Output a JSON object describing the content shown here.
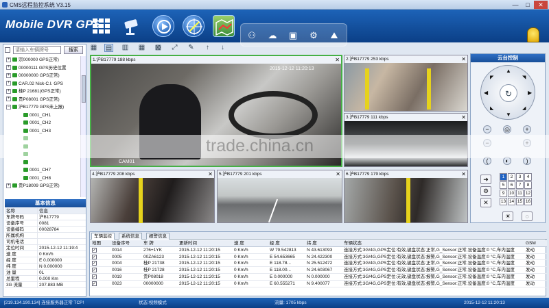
{
  "window": {
    "title": "CMS远程监控系统 V3.15",
    "min": "—",
    "max": "□",
    "close": "✕"
  },
  "header": {
    "brand": "Mobile DVR GPS"
  },
  "leftpanel": {
    "search_placeholder": "请输入车辆牌号",
    "search_button": "搜索",
    "tree": [
      {
        "label": "宗000000 GPS正常)",
        "exp": "+",
        "indent": 0
      },
      {
        "label": "00000111 GPS历史位置",
        "exp": "+",
        "indent": 0
      },
      {
        "label": "00000000 GPS正常)",
        "exp": "+",
        "indent": 0
      },
      {
        "label": "CAR.02 Nick-C.I. GPS",
        "exp": "+",
        "indent": 0
      },
      {
        "label": "桂P 21681(GPS正常)",
        "exp": "+",
        "indent": 0
      },
      {
        "label": "贵P08001 GPS正常)",
        "exp": "+",
        "indent": 0
      },
      {
        "label": "沪B17779 GPS未上报)",
        "exp": "−",
        "indent": 0
      },
      {
        "label": "0001_CH1",
        "exp": "",
        "indent": 1
      },
      {
        "label": "0001_CH2",
        "exp": "",
        "indent": 1
      },
      {
        "label": "0001_CH3",
        "exp": "",
        "indent": 1
      },
      {
        "label": "",
        "exp": "",
        "indent": 1
      },
      {
        "label": "",
        "exp": "",
        "indent": 1
      },
      {
        "label": "",
        "exp": "",
        "indent": 1
      },
      {
        "label": "",
        "exp": "",
        "indent": 1
      },
      {
        "label": "0001_CH7",
        "exp": "",
        "indent": 1
      },
      {
        "label": "0001_CH8",
        "exp": "",
        "indent": 1
      },
      {
        "label": "贵P18009 GPS正常)",
        "exp": "+",
        "indent": 0
      }
    ],
    "info_title": "基本信息",
    "info": [
      {
        "k": "名称",
        "v": "信息"
      },
      {
        "k": "车牌号码",
        "v": "沪B17779"
      },
      {
        "k": "设备序号",
        "v": "0081"
      },
      {
        "k": "设备编码",
        "v": "00028784"
      },
      {
        "k": "所属机构",
        "v": ""
      },
      {
        "k": "司机电话",
        "v": ""
      },
      {
        "k": "定位时间",
        "v": "2015-12-12 11:19:4"
      },
      {
        "k": "速 度",
        "v": "0 Km/h"
      },
      {
        "k": "经 度",
        "v": "E 0.000000"
      },
      {
        "k": "纬 度",
        "v": "N 0.000000"
      },
      {
        "k": "油 量",
        "v": "0L"
      },
      {
        "k": "总里程",
        "v": "0.000 Km"
      },
      {
        "k": "3G 流量",
        "v": "207.883 MB"
      }
    ]
  },
  "videos": [
    {
      "label": "1.沪B17779 188 kbps",
      "ts": "2015-12-12 11:20:13",
      "cam": "CAM01"
    },
    {
      "label": "2.沪B17779 253 kbps"
    },
    {
      "label": "3.沪B17779 111 kbps"
    },
    {
      "label": "4.沪B17779 208 kbps"
    },
    {
      "label": "5.沪B17779 201 kbps"
    },
    {
      "label": "6.沪B17779 179 kbps"
    }
  ],
  "ptz": {
    "title": "云台控制",
    "nums": [
      "1",
      "2",
      "3",
      "4",
      "5",
      "6",
      "7",
      "8",
      "9",
      "10",
      "11",
      "12",
      "13",
      "14",
      "15",
      "16"
    ]
  },
  "bottom": {
    "tabs": [
      "车辆监控",
      "系统信息",
      "报警信息"
    ],
    "headers": [
      "地图",
      "设备序号",
      "车 牌",
      "更新时间",
      "速 度",
      "经 度",
      "纬 度",
      "车辆状态",
      "GSM"
    ],
    "rows": [
      [
        "0014",
        "276+1YK",
        "2015-12-12 11:20:15",
        "0 Km/h",
        "W 79.542813",
        "N 43.613093",
        "连接方式:3G/4G,GPS定位:有效,键盘状态:正常,G_Sensor:正常,设备温度:0 °C,车内温度",
        "发动"
      ],
      [
        "0005",
        "00ZA6123",
        "2015-12-12 11:20:15",
        "0 Km/h",
        "E 54.653665",
        "N 24.422300",
        "连接方式:3G/4G,GPS定位:有效,键盘状态:报警,G_Sensor:正常,设备温度:0 °C,车内温度",
        "发动"
      ],
      [
        "0004",
        "桂P 21738",
        "2015-12-12 11:20:15",
        "0 Km/h",
        "E 118.78...",
        "N 25.512472",
        "连接方式:3G/4G,GPS定位:有效,键盘状态:正常,G_Sensor:正常,设备温度:0 °C,车内温度",
        "发动"
      ],
      [
        "0016",
        "桂P 21728",
        "2015-12-12 11:20:15",
        "0 Km/h",
        "E 118.00...",
        "N 24.603067",
        "连接方式:3G/4G,GPS定位:有效,键盘状态:报警,G_Sensor:正常,设备温度:0 °C,车内温度",
        "发动"
      ],
      [
        "0019",
        "贵P08018",
        "2015-12-12 11:20:15",
        "0 Km/h",
        "E 0.000000",
        "N 0.000000",
        "连接方式:3G/4G,GPS定位:无效,键盘状态:报警,G_Sensor:正常,设备温度:0 °C,车内温度",
        "发动"
      ],
      [
        "0023",
        "00000000",
        "2015-12-12 11:20:15",
        "0 Km/h",
        "E 60.555271",
        "N 9.400077",
        "连接方式:3G/4G,GPS定位:有效,键盘状态:报警,G_Sensor:正常,设备温度:0 °C,车内温度",
        "发动"
      ]
    ]
  },
  "status": {
    "server": "[219.134.190.134] 连接服务器正常 TCP!",
    "mode": "状态:视频模式",
    "flow": "流量: 1705 kbps",
    "time": "2015-12-12 11:20:13"
  },
  "watermark": "trade.china.cn"
}
